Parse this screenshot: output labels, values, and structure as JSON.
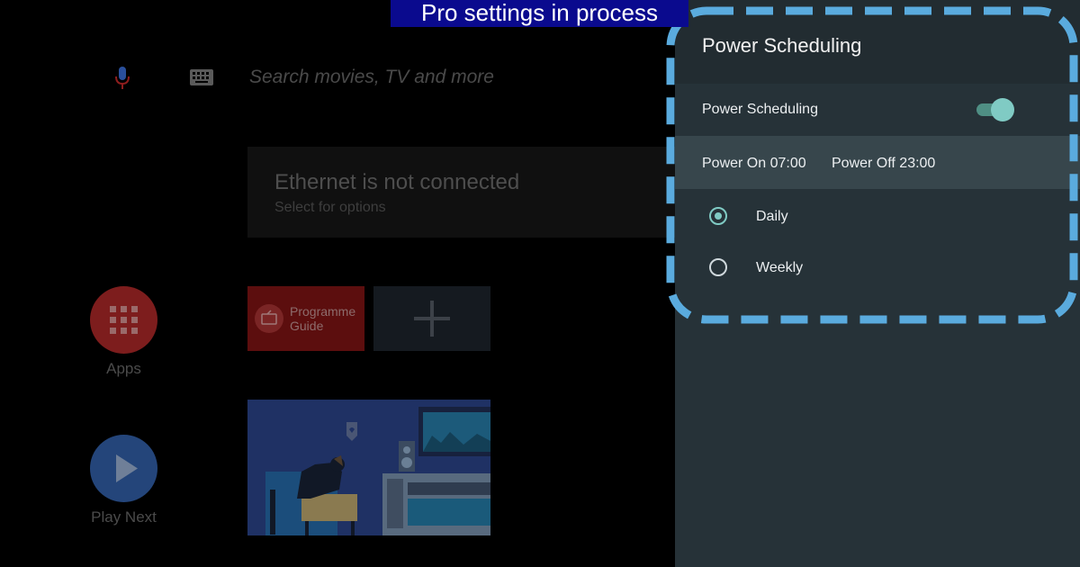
{
  "banner": {
    "text": "Pro settings in process"
  },
  "search": {
    "placeholder": "Search movies, TV and more",
    "mic_icon": "mic-icon",
    "keyboard_icon": "keyboard-icon"
  },
  "network_card": {
    "title": "Ethernet is not connected",
    "subtitle": "Select for options"
  },
  "nav": {
    "apps_label": "Apps",
    "play_next_label": "Play Next",
    "apps_icon": "grid-icon",
    "play_icon": "play-icon"
  },
  "tiles": {
    "guide_label_line1": "Programme",
    "guide_label_line2": "Guide",
    "add_icon": "plus-icon"
  },
  "panel": {
    "title": "Power Scheduling",
    "toggle_label": "Power Scheduling",
    "toggle_on": true,
    "power_on_label": "Power On  07:00",
    "power_off_label": "Power Off  23:00",
    "options": [
      {
        "label": "Daily",
        "selected": true
      },
      {
        "label": "Weekly",
        "selected": false
      }
    ]
  },
  "colors": {
    "panel_bg": "#263238",
    "accent": "#80cbc4",
    "banner_bg": "#0a0a8e",
    "highlight": "#5aabde"
  }
}
